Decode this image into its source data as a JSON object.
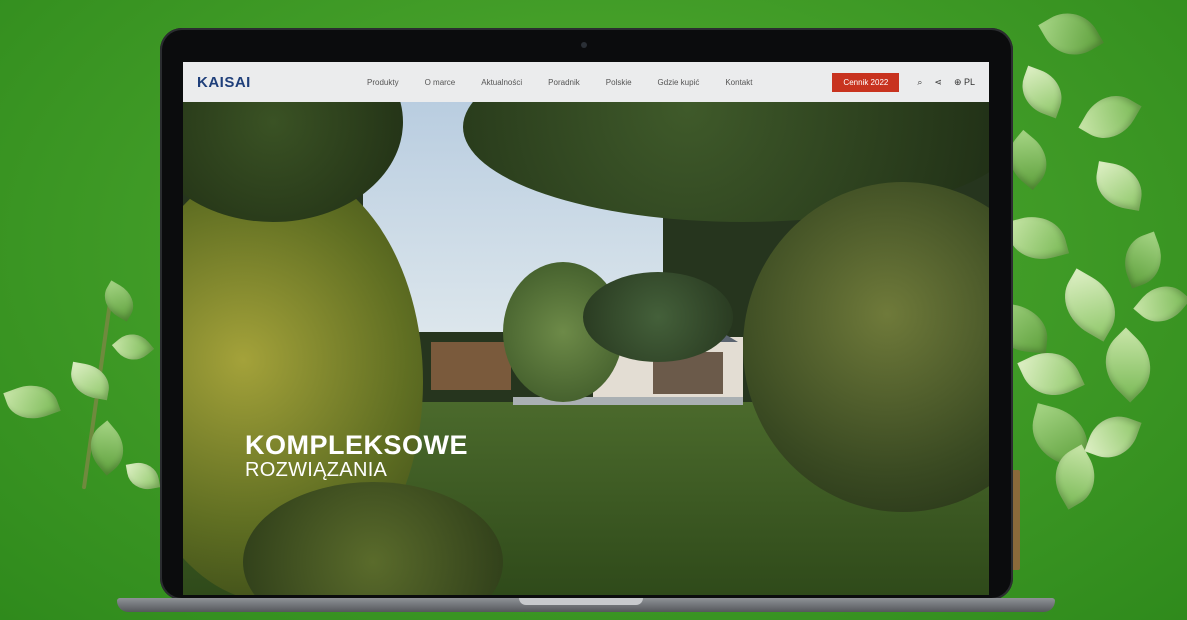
{
  "site": {
    "logo": "KAISAI",
    "nav": [
      "Produkty",
      "O marce",
      "Aktualności",
      "Poradnik",
      "Polskie",
      "Gdzie kupić",
      "Kontakt"
    ],
    "cta_label": "Cennik 2022",
    "tools": {
      "search": "⌕",
      "share": "⋖",
      "language": "⊕ PL"
    }
  },
  "hero": {
    "title_line1": "KOMPLEKSOWE",
    "title_line2": "ROZWIĄZANIA"
  },
  "colors": {
    "background": "#4aa52c",
    "cta": "#c8331f",
    "logo": "#1f3f7a",
    "header": "#ebeced"
  }
}
